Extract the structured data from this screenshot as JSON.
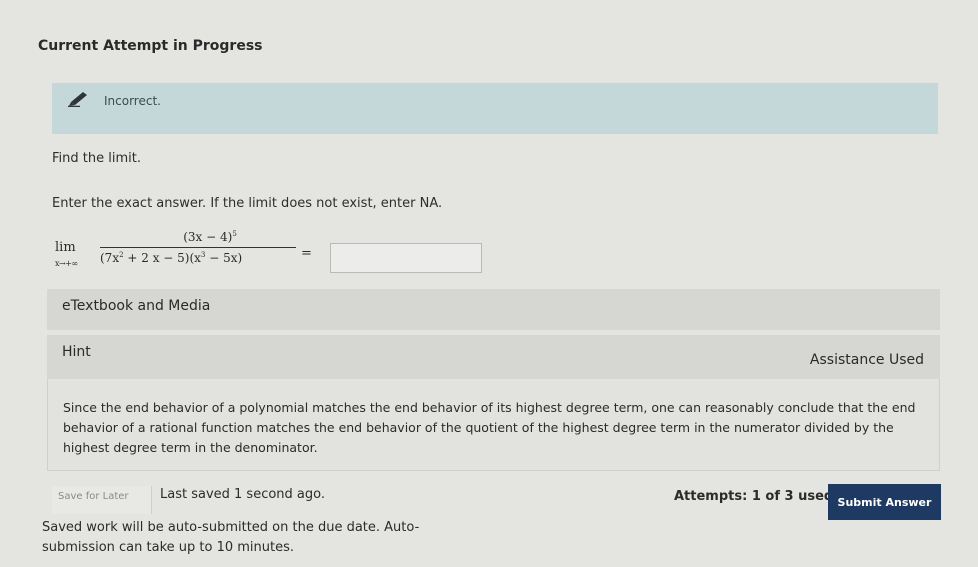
{
  "header": {
    "title": "Current Attempt in Progress"
  },
  "feedback": {
    "status": "Incorrect."
  },
  "question": {
    "prompt": "Find the limit.",
    "instruction": "Enter the exact answer. If the limit does not exist, enter NA.",
    "lim_word": "lim",
    "lim_sub": "x→+∞",
    "numerator_base": "(3x − 4)",
    "numerator_exp": "5",
    "den_part1": "(7x",
    "den_exp1": "2",
    "den_part2": " + 2 x − 5)(x",
    "den_exp2": "3",
    "den_part3": " − 5x)",
    "equals": "=",
    "answer_value": ""
  },
  "resources": {
    "etextbook_label": "eTextbook and Media",
    "hint_label": "Hint",
    "assistance_label": "Assistance Used",
    "hint_text": "Since the end behavior of a polynomial matches the end behavior of its highest degree term, one can reasonably conclude that the end behavior of a rational function matches the end behavior of the quotient of the highest degree term in the numerator divided by the highest degree term in the denominator."
  },
  "footer": {
    "save_later_label": "Save for Later",
    "last_saved": "Last saved 1 second ago.",
    "attempts": "Attempts: 1 of 3 used",
    "submit_label": "Submit Answer",
    "auto_submit_note": "Saved work will be auto-submitted on the due date. Auto-submission can take up to 10 minutes."
  },
  "colors": {
    "banner": "#c5d8d9",
    "submit": "#1f3a62"
  }
}
